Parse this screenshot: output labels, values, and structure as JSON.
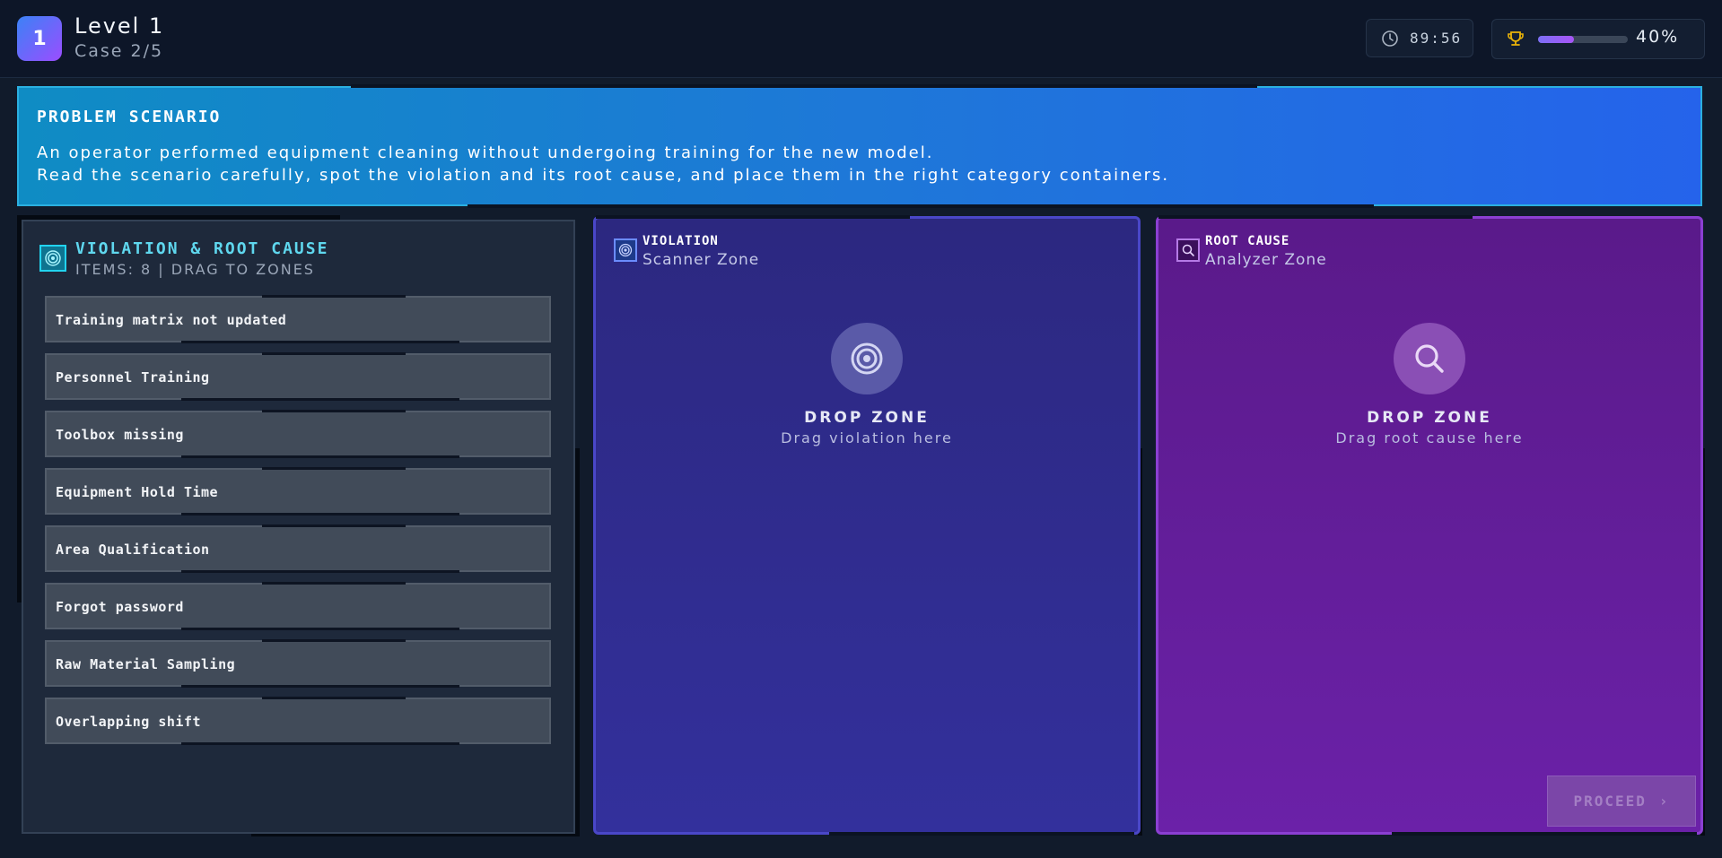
{
  "header": {
    "level_number": "1",
    "level_title": "Level 1",
    "case_label": "Case 2/5",
    "timer": "89:56",
    "progress_percent": 40,
    "progress_label": "40%"
  },
  "scenario": {
    "title": "PROBLEM SCENARIO",
    "line1": "An operator performed equipment cleaning without undergoing training for the new model.",
    "line2": "Read the scenario carefully, spot the violation and its root cause, and place them in the right category containers."
  },
  "items_panel": {
    "title": "VIOLATION & ROOT CAUSE",
    "subtitle": "ITEMS: 8 | DRAG TO ZONES",
    "items": [
      "Training matrix not updated",
      "Personnel Training",
      "Toolbox missing",
      "Equipment Hold Time",
      "Area Qualification",
      "Forgot password",
      "Raw Material Sampling",
      "Overlapping shift"
    ]
  },
  "violation_zone": {
    "label": "VIOLATION",
    "sublabel": "Scanner Zone",
    "drop_title": "DROP ZONE",
    "drop_hint": "Drag violation here"
  },
  "root_zone": {
    "label": "ROOT CAUSE",
    "sublabel": "Analyzer Zone",
    "drop_title": "DROP ZONE",
    "drop_hint": "Drag root cause here"
  },
  "proceed": {
    "label": "PROCEED",
    "chevron": "›"
  },
  "colors": {
    "background": "#111b2b",
    "accent_cyan": "#22d3ee",
    "violation_zone": "#33309c",
    "root_zone": "#6b21a8"
  },
  "icons": {
    "timer": "clock-icon",
    "score": "trophy-icon",
    "items_panel": "target-icon",
    "violation": "target-icon",
    "root_cause": "search-icon"
  }
}
